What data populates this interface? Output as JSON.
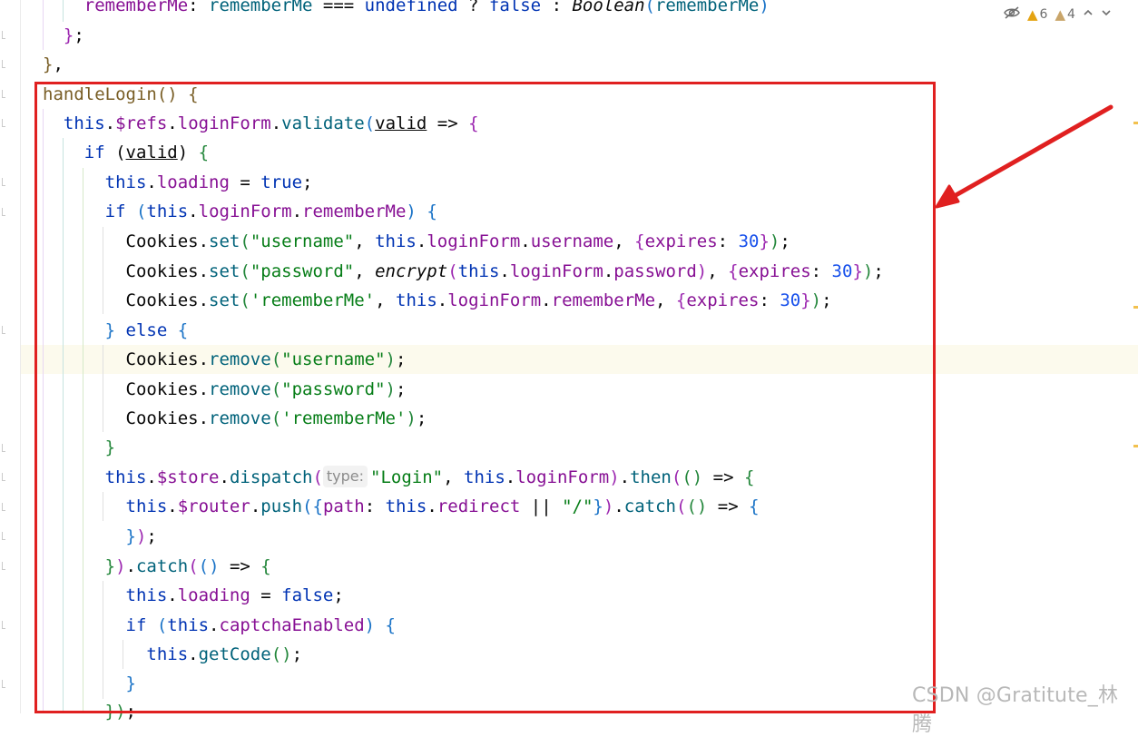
{
  "inspections": {
    "warnings": "6",
    "weak_warnings": "4",
    "warning_color": "#e4a312",
    "weak_warning_color": "#c9a56a"
  },
  "code": {
    "line01": {
      "a": "    rememberMe",
      "b": ": ",
      "c": "rememberMe",
      "d": " === ",
      "e": "undefined",
      "f": " ? ",
      "g": "false",
      "h": " : ",
      "i": "Boolean",
      "j": "(",
      "k": "rememberMe",
      "l": ")"
    },
    "line02": {
      "a": "  }",
      "b": ";"
    },
    "line03": {
      "a": "}",
      "b": ","
    },
    "line04": {
      "a": "handleLogin",
      "b": "() {"
    },
    "line05": {
      "a": "  this",
      "b": ".",
      "c": "$refs",
      "d": ".",
      "e": "loginForm",
      "f": ".",
      "g": "validate",
      "h": "(",
      "i": "valid",
      "j": " => ",
      "k": "{"
    },
    "line06": {
      "a": "    if",
      "b": " (",
      "c": "valid",
      "d": ") ",
      "e": "{"
    },
    "line07": {
      "a": "      this",
      "b": ".",
      "c": "loading",
      "d": " = ",
      "e": "true",
      "f": ";"
    },
    "line08": {
      "a": "      if",
      "b": " (",
      "c": "this",
      "d": ".",
      "e": "loginForm",
      "f": ".",
      "g": "rememberMe",
      "h": ") ",
      "i": "{"
    },
    "line09": {
      "a": "        Cookies",
      "b": ".",
      "c": "set",
      "d": "(",
      "e": "\"username\"",
      "f": ", ",
      "g": "this",
      "h": ".",
      "i": "loginForm",
      "j": ".",
      "k": "username",
      "l": ", ",
      "m": "{",
      "n": "expires",
      "o": ": ",
      "p": "30",
      "q": "}",
      "r": ")",
      "s": ";"
    },
    "line10": {
      "a": "        Cookies",
      "b": ".",
      "c": "set",
      "d": "(",
      "e": "\"password\"",
      "f": ", ",
      "g": "encrypt",
      "h": "(",
      "i": "this",
      "j": ".",
      "k": "loginForm",
      "l": ".",
      "m": "password",
      "n": ")",
      "o": ", ",
      "p": "{",
      "q": "expires",
      "r": ": ",
      "s": "30",
      "t": "}",
      "u": ")",
      "v": ";"
    },
    "line11": {
      "a": "        Cookies",
      "b": ".",
      "c": "set",
      "d": "(",
      "e": "'rememberMe'",
      "f": ", ",
      "g": "this",
      "h": ".",
      "i": "loginForm",
      "j": ".",
      "k": "rememberMe",
      "l": ", ",
      "m": "{",
      "n": "expires",
      "o": ": ",
      "p": "30",
      "q": "}",
      "r": ")",
      "s": ";"
    },
    "line12": {
      "a": "      }",
      "b": " else ",
      "c": "{"
    },
    "line13": {
      "a": "        Cookies",
      "b": ".",
      "c": "remove",
      "d": "(",
      "e": "\"username\"",
      "f": ")",
      "g": ";"
    },
    "line14": {
      "a": "        Cookies",
      "b": ".",
      "c": "remove",
      "d": "(",
      "e": "\"password\"",
      "f": ")",
      "g": ";"
    },
    "line15": {
      "a": "        Cookies",
      "b": ".",
      "c": "remove",
      "d": "(",
      "e": "'rememberMe'",
      "f": ")",
      "g": ";"
    },
    "line16": {
      "a": "      }"
    },
    "line17": {
      "a": "      this",
      "b": ".",
      "c": "$store",
      "d": ".",
      "e": "dispatch",
      "f": "(",
      "g": "type:",
      "h": "\"Login\"",
      "i": ", ",
      "j": "this",
      "k": ".",
      "l": "loginForm",
      "m": ")",
      "n": ".",
      "o": "then",
      "p": "(",
      "q": "()",
      "r": " => ",
      "s": "{"
    },
    "line18": {
      "a": "        this",
      "b": ".",
      "c": "$router",
      "d": ".",
      "e": "push",
      "f": "(",
      "g": "{",
      "h": "path",
      "i": ": ",
      "j": "this",
      "k": ".",
      "l": "redirect",
      "m": " || ",
      "n": "\"/\"",
      "o": "}",
      "p": ")",
      "q": ".",
      "r": "catch",
      "s": "(",
      "t": "()",
      "u": " => ",
      "v": "{"
    },
    "line19": {
      "a": "        }",
      "b": ")",
      "c": ";"
    },
    "line20": {
      "a": "      }",
      "b": ")",
      "c": ".",
      "d": "catch",
      "e": "(",
      "f": "()",
      "g": " => ",
      "h": "{"
    },
    "line21": {
      "a": "        this",
      "b": ".",
      "c": "loading",
      "d": " = ",
      "e": "false",
      "f": ";"
    },
    "line22": {
      "a": "        if",
      "b": " (",
      "c": "this",
      "d": ".",
      "e": "captchaEnabled",
      "f": ") ",
      "g": "{"
    },
    "line23": {
      "a": "          this",
      "b": ".",
      "c": "getCode",
      "d": "()",
      "e": ";"
    },
    "line24": {
      "a": "        }"
    },
    "line25": {
      "a": "      })",
      "b": ";"
    }
  },
  "watermark": "CSDN @Gratitute_林腾",
  "annotation": {
    "box_color": "#e02020",
    "arrow_color": "#e02020"
  }
}
